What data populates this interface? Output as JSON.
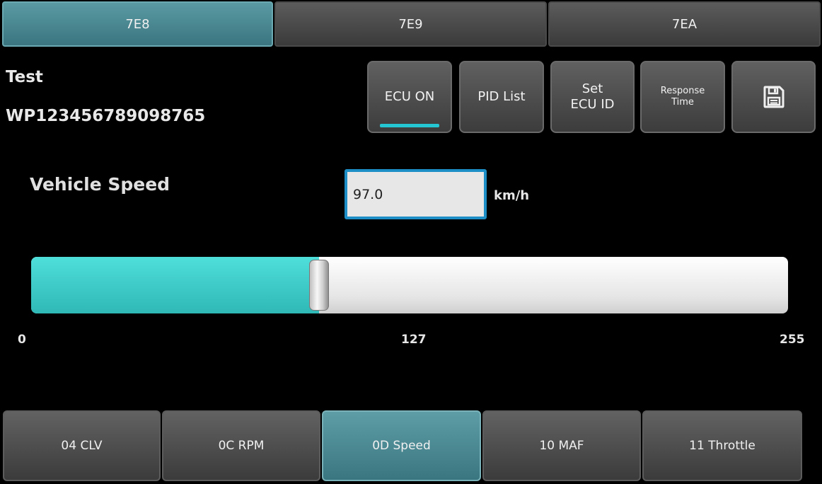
{
  "ecu_tabs": [
    {
      "label": "7E8",
      "active": true
    },
    {
      "label": "7E9",
      "active": false
    },
    {
      "label": "7EA",
      "active": false
    }
  ],
  "info": {
    "title": "Test",
    "vin": "WP123456789098765"
  },
  "actions": {
    "ecu_on": "ECU ON",
    "pid_list": "PID List",
    "set_ecu_id_line1": "Set",
    "set_ecu_id_line2": "ECU ID",
    "response_time_line1": "Response",
    "response_time_line2": "Time",
    "save_icon": "floppy-disk-icon"
  },
  "pid": {
    "label": "Vehicle Speed",
    "value": "97.0",
    "unit": "km/h"
  },
  "slider": {
    "min_label": "0",
    "mid_label": "127",
    "max_label": "255",
    "min": 0,
    "max": 255,
    "value": 97.0
  },
  "pid_tabs": [
    {
      "label": "04 CLV",
      "active": false
    },
    {
      "label": "0C RPM",
      "active": false
    },
    {
      "label": "0D Speed",
      "active": true
    },
    {
      "label": "10 MAF",
      "active": false
    },
    {
      "label": "11 Throttle",
      "active": false
    }
  ],
  "colors": {
    "accent": "#25c6d3",
    "active_tab": "#4a8891",
    "slider_fill": "#3fcfcc"
  }
}
